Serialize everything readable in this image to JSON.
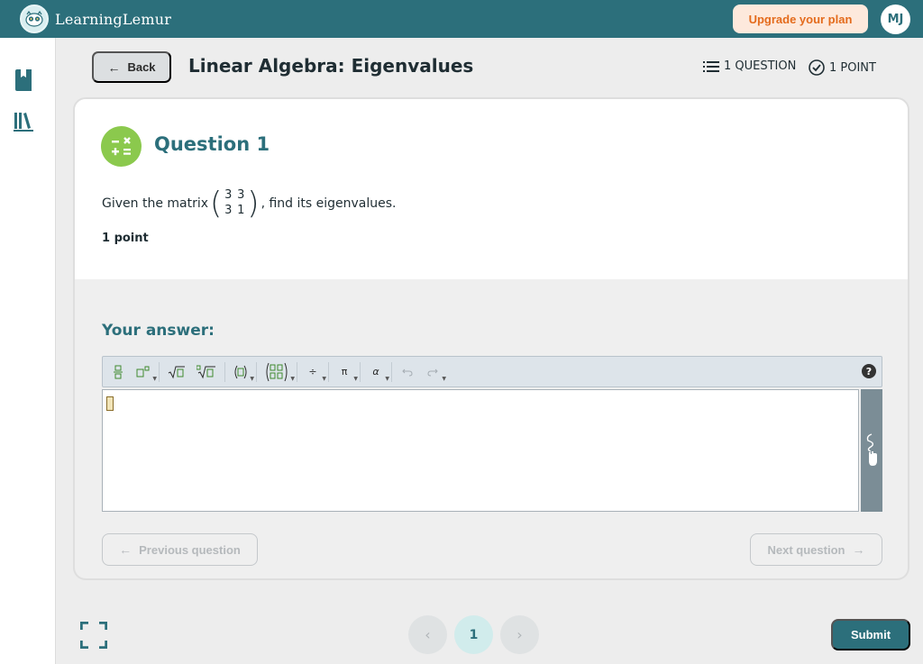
{
  "app": {
    "name": "LearningLemur"
  },
  "header": {
    "upgrade_label": "Upgrade your plan",
    "avatar_initials": "MJ"
  },
  "page": {
    "back_label": "Back",
    "title": "Linear Algebra: Eigenvalues",
    "question_count": "1 QUESTION",
    "points_total": "1 POINT"
  },
  "question": {
    "title": "Question 1",
    "text_before": "Given the matrix",
    "text_after": ", find its eigenvalues.",
    "matrix": [
      "3",
      "3",
      "3",
      "1"
    ],
    "points": "1 point"
  },
  "answer": {
    "label": "Your answer:",
    "toolbar": {
      "items": [
        "fraction",
        "superscript",
        "sqrt",
        "nth-root",
        "parentheses",
        "matrix",
        "divide",
        "pi",
        "alpha",
        "undo",
        "redo"
      ],
      "labels": {
        "divide": "÷",
        "pi": "π",
        "alpha": "α",
        "help": "?"
      }
    }
  },
  "navigation": {
    "previous_label": "Previous question",
    "next_label": "Next question",
    "current_page": "1"
  },
  "footer": {
    "submit_label": "Submit"
  },
  "colors": {
    "brand": "#2c6f7b",
    "upgrade_text": "#e46b1c",
    "upgrade_bg": "#fde9dc",
    "badge": "#8bc94d"
  }
}
